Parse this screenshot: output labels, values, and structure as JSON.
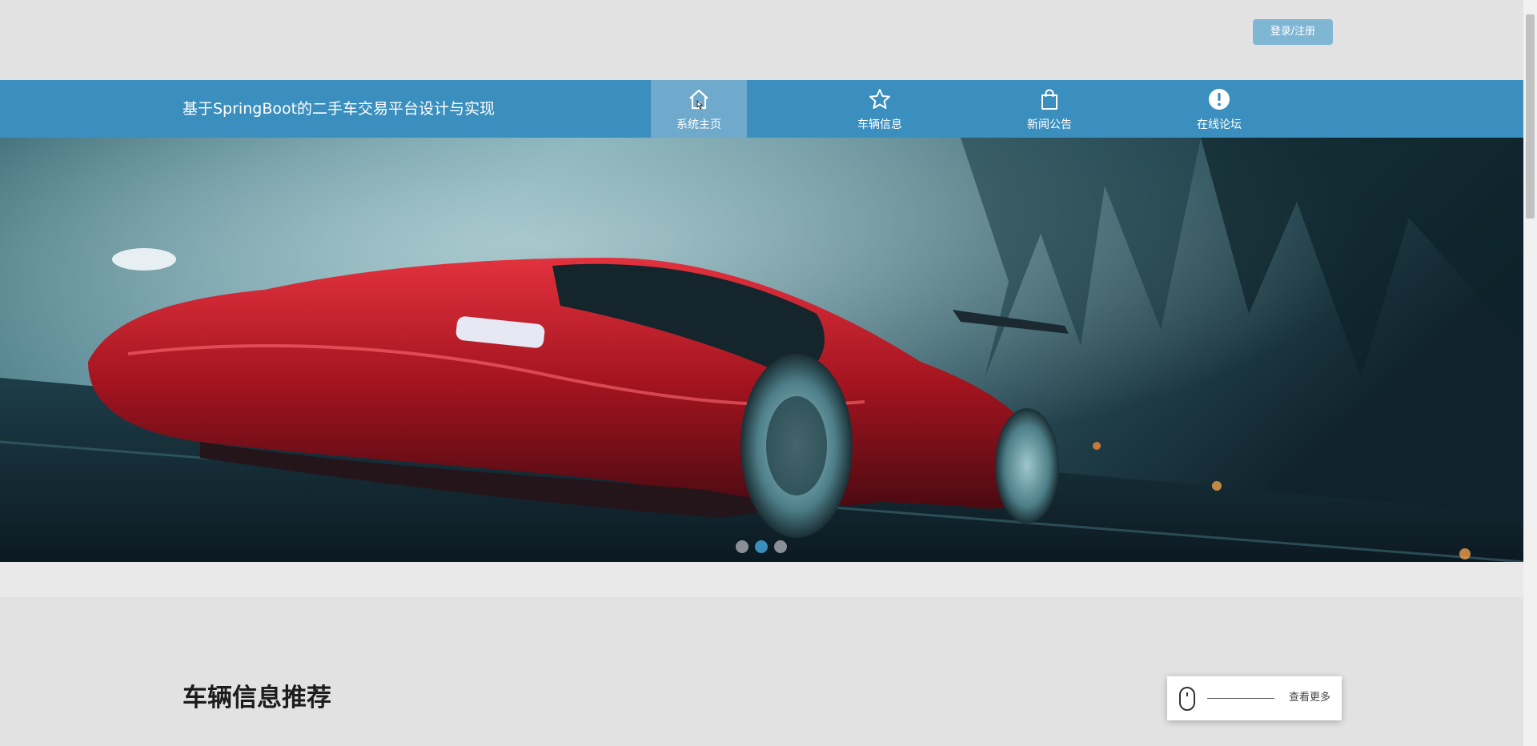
{
  "header": {
    "login_label": "登录/注册",
    "site_title": "基于SpringBoot的二手车交易平台设计与实现"
  },
  "nav": {
    "items": [
      {
        "label": "系统主页",
        "icon": "home-icon",
        "active": true
      },
      {
        "label": "车辆信息",
        "icon": "star-icon",
        "active": false
      },
      {
        "label": "新闻公告",
        "icon": "shopping-bag-icon",
        "active": false
      },
      {
        "label": "在线论坛",
        "icon": "exclamation-circle-icon",
        "active": false
      }
    ]
  },
  "banner": {
    "image": "red-sports-car-banner",
    "slides_count": 3,
    "active_slide": 2
  },
  "section": {
    "title": "车辆信息推荐",
    "more_label": "查看更多"
  },
  "colors": {
    "nav_bg": "#3b8fbe",
    "nav_active_bg": "#6fa9cb",
    "login_bg": "#7fb6d4",
    "page_bg": "#e2e2e2"
  }
}
